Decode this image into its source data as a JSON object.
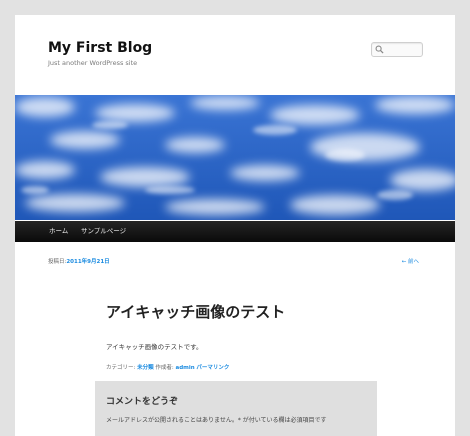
{
  "site": {
    "title": "My First Blog",
    "description": "Just another WordPress site"
  },
  "search": {
    "placeholder": ""
  },
  "nav": {
    "items": [
      {
        "label": "ホーム"
      },
      {
        "label": "サンプルページ"
      }
    ]
  },
  "post": {
    "meta_prefix": "投稿日:",
    "date": "2011年9月21日",
    "prev_link": "← 前へ",
    "title": "アイキャッチ画像のテスト",
    "content": "アイキャッチ画像のテストです。",
    "footer": {
      "category_label": "カテゴリー:",
      "category": "未分類",
      "author_label": "作成者:",
      "author": "admin",
      "permalink": "パーマリンク"
    }
  },
  "comments": {
    "reply_title": "コメントをどうぞ",
    "notes": "メールアドレスが公開されることはありません。* が付いている欄は必須項目です"
  },
  "colors": {
    "link": "#1b8be0",
    "sky": "#2a66c6",
    "menu_bar": "#111111"
  }
}
